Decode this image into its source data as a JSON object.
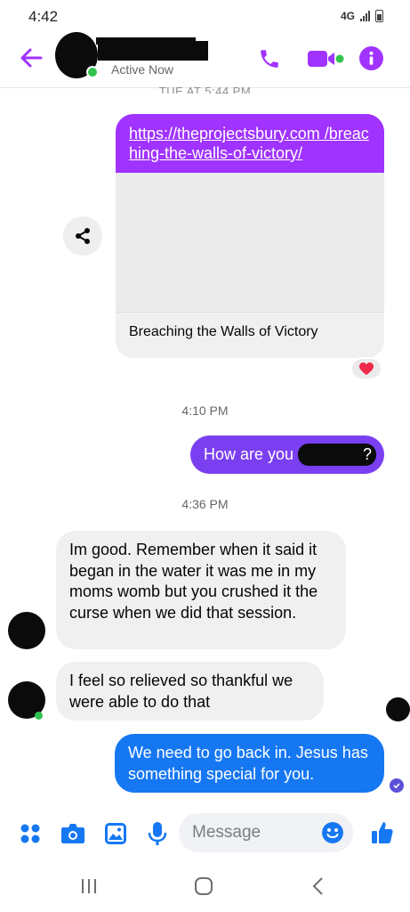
{
  "status_bar": {
    "time": "4:42",
    "network": "4G"
  },
  "header": {
    "status": "Active Now",
    "icons": [
      "back-arrow-icon",
      "phone-icon",
      "video-call-icon",
      "info-icon"
    ],
    "accent_color": "#a033ff"
  },
  "messages": {
    "top_timestamp": "TUE AT 5:44 PM",
    "link_card": {
      "url": "https://theprojectsbury.com /breaching-the-walls-of-victory/",
      "title": "Breaching the Walls of Victory",
      "reaction": "heart"
    },
    "ts1": "4:10 PM",
    "outgoing1": "How are you",
    "outgoing1_tail": "?",
    "ts2": "4:36 PM",
    "incoming1": "Im good. Remember when it said it began in the water it was me in my moms womb but you crushed it the curse when we did that session.",
    "incoming2": "I feel so relieved  so thankful we were able to do that",
    "outgoing2": "We need to go back in.  Jesus has something special for you."
  },
  "composer": {
    "placeholder": "Message",
    "icons": [
      "menu-dots-icon",
      "camera-icon",
      "gallery-icon",
      "microphone-icon",
      "emoji-icon",
      "thumbs-up-icon"
    ]
  },
  "colors": {
    "outgoing_purple": "#7b3ff2",
    "outgoing_blue": "#1677f2",
    "incoming_gray": "#f0f0f0"
  }
}
